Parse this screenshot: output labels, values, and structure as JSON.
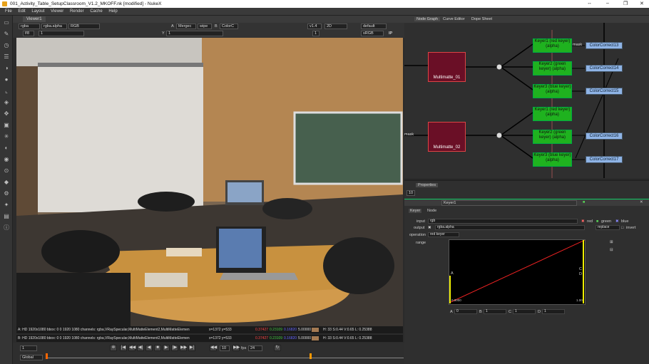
{
  "window": {
    "title": "001_Activity_Table_SetupClassroom_V1.2_MKOFF.nk [modified] - NukeX",
    "controls": [
      "↔",
      "–",
      "❐",
      "✕"
    ]
  },
  "menu": [
    "File",
    "Edit",
    "Layout",
    "Viewer",
    "Render",
    "Cache",
    "Help"
  ],
  "viewer": {
    "tab": "Viewer1",
    "channels": "rgba",
    "layer": "rgba.alpha",
    "display": "RGB",
    "input_a": "A",
    "merge_op": "Mergec",
    "wipe": "wipe",
    "input_b": "B",
    "input_b_node": "ColorC",
    "frame_field": "f/8",
    "frame_value": "1",
    "y_label": "Y",
    "gain_value": "1",
    "zoom": "v1.4",
    "view_mode": "2D",
    "lut": "default",
    "colorspace": "sRGB",
    "proxy": "1",
    "ip": "IP",
    "info_a": {
      "prefix": "A: HD 1920x1080 bbox: 0 0 1920 1080 channels: rgba,VRaySpecular,MultiMatteElement2,MultiMatteElemen",
      "coords": "x=1372 y=533",
      "r": "0.37427",
      "g": "0.23109",
      "b": "0.16820",
      "a": "5.00000",
      "hsv": "H: 33 S:0.44 V:0.65  L: 0.25388"
    },
    "info_b": {
      "prefix": "B: HD 1920x1080 bbox: 0 0 1920 1080 channels: rgba,VRaySpecular,MultiMatteElement2,MultiMatteElemen",
      "coords": "x=1372 y=533",
      "r": "0.37427",
      "g": "0.23109",
      "b": "0.16820",
      "a": "5.00000",
      "hsv": "H: 33 S:0.44 V:0.65  L: 0.25388"
    }
  },
  "timeline": {
    "frame": "1",
    "global": "Global",
    "fps_label": "fps",
    "fps": "24",
    "step": "10"
  },
  "nodegraph": {
    "tabs": [
      "Node Graph",
      "Curve Editor",
      "Dope Sheet"
    ],
    "multimatte": [
      "Multimatte_01",
      "Multimatte_02"
    ],
    "keyers": [
      "Keyer1 (red keyer) (alpha)",
      "Keyer2 (green keyer) (alpha)",
      "Keyer3 (blue keyer) (alpha)",
      "Keyer1 (red keyer) (alpha)",
      "Keyer2 (green keyer) (alpha)",
      "Keyer3 (blue keyer) (alpha)"
    ],
    "colorcorrects": [
      "ColorCorrect13",
      "ColorCorrect14",
      "ColorCorrect15",
      "ColorCorrect16",
      "ColorCorrect17"
    ],
    "mask_label": "mask"
  },
  "properties": {
    "tab": "Properties",
    "max_panels": "10",
    "node_name": "Keyer1",
    "subtabs": [
      "Keyer",
      "Node"
    ],
    "input_label": "input",
    "input_value": "rgb",
    "red": "red",
    "green": "green",
    "blue": "blue",
    "output_label": "output",
    "output_value": "rgba.alpha",
    "output_mode": "replace",
    "invert": "invert",
    "operation_label": "operation",
    "operation_value": "red keyer",
    "range_label": "range",
    "curve_A": "A",
    "curve_C": "C",
    "curve_D": "D",
    "curve_B": "B",
    "curve_start": "0.0000",
    "curve_end": "1.00",
    "fields": {
      "A": "0",
      "B": "1",
      "C": "1",
      "D": "1"
    }
  }
}
